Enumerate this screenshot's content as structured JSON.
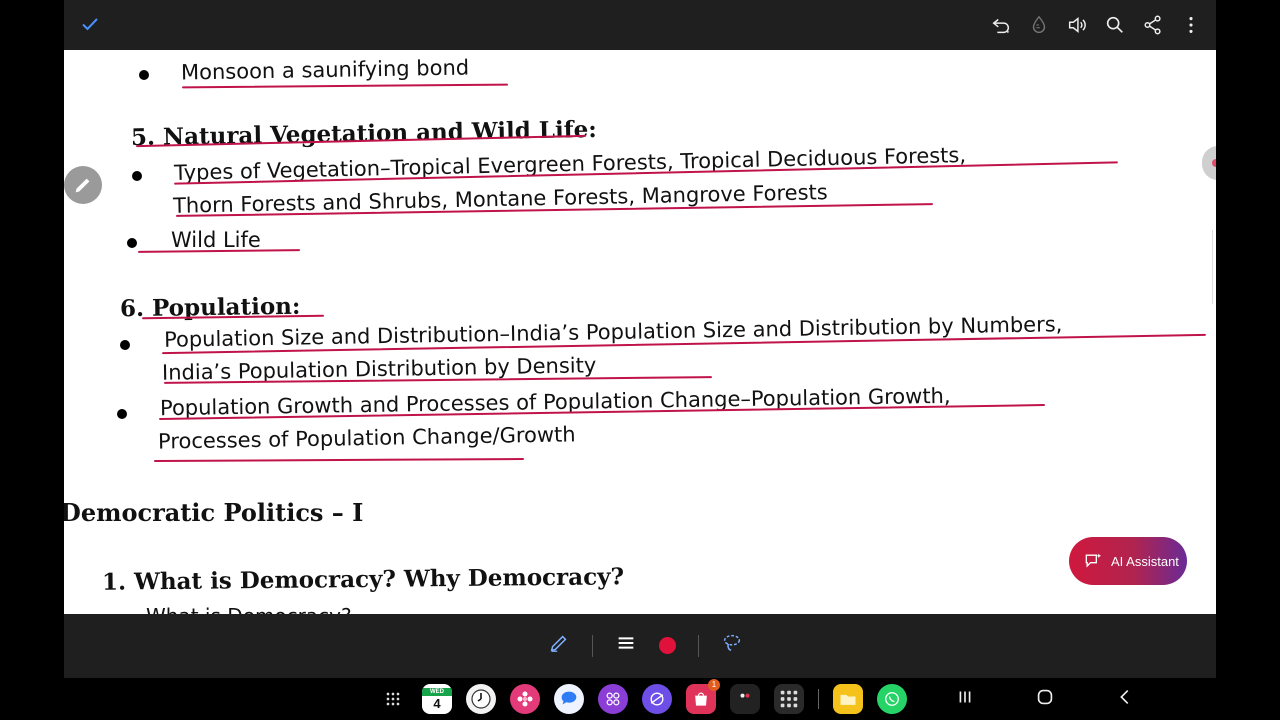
{
  "toolbar": {
    "icons": [
      "check-icon",
      "undo-icon",
      "ink-drop-icon",
      "volume-icon",
      "search-icon",
      "share-icon",
      "more-vertical-icon"
    ]
  },
  "notes": {
    "monsoon": "Monsoon a saunifying bond",
    "s5_title": "5. Natural Vegetation and Wild Life:",
    "s5_b1_l1": "Types of Vegetation–Tropical Evergreen Forests, Tropical Deciduous Forests,",
    "s5_b1_l2": "Thorn Forests and Shrubs, Montane Forests, Mangrove Forests",
    "s5_b2": "Wild Life",
    "s6_title": "6. Population:",
    "s6_b1_l1": "Population Size and Distribution–India’s Population Size and Distribution by Numbers,",
    "s6_b1_l2": "India’s Population Distribution by Density",
    "s6_b2_l1": "Population Growth and Processes of Population Change–Population Growth,",
    "s6_b2_l2": "Processes of  Population Change/Growth",
    "dp_title": "Democratic Politics – I",
    "dp_q1": "1. What is Democracy? Why Democracy?",
    "dp_cut": "What is Democracy?"
  },
  "ai_assistant": {
    "label": "AI Assistant"
  },
  "pen_toolbar": {
    "icons": [
      "pen-edit-icon",
      "menu-icon",
      "red-color-icon",
      "lasso-select-icon"
    ],
    "pen_color": "#e0113a"
  },
  "taskbar": {
    "calendar_day": "WED",
    "calendar_date": "4",
    "shop_badge": "1",
    "apps": [
      "app-drawer-icon",
      "calendar-app",
      "clock-app",
      "gallery-app",
      "messages-app",
      "apps-folder",
      "browser-app",
      "store-app",
      "camera-app",
      "app-grid",
      "files-app",
      "whatsapp-app"
    ],
    "nav": [
      "recents-icon",
      "home-icon",
      "back-icon"
    ]
  },
  "colors": {
    "underline": "#c0134a",
    "toolbar_bg": "#1f1f1f",
    "accent_check": "#4a90ff"
  }
}
